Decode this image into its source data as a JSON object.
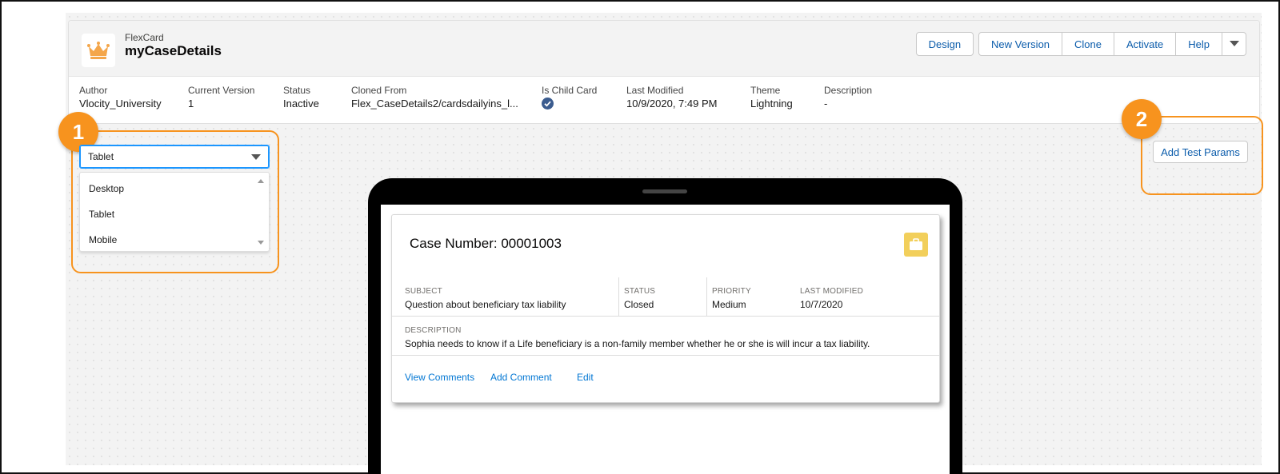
{
  "header": {
    "object_type": "FlexCard",
    "title": "myCaseDetails",
    "buttons": {
      "design": "Design",
      "new_version": "New Version",
      "clone": "Clone",
      "activate": "Activate",
      "help": "Help"
    },
    "fields": {
      "author": {
        "label": "Author",
        "value": "Vlocity_University"
      },
      "current_version": {
        "label": "Current Version",
        "value": "1"
      },
      "status": {
        "label": "Status",
        "value": "Inactive"
      },
      "cloned_from": {
        "label": "Cloned From",
        "value": "Flex_CaseDetails2/cardsdailyins_l..."
      },
      "is_child_card": {
        "label": "Is Child Card"
      },
      "last_modified": {
        "label": "Last Modified",
        "value": "10/9/2020, 7:49 PM"
      },
      "theme": {
        "label": "Theme",
        "value": "Lightning"
      },
      "description": {
        "label": "Description",
        "value": "-"
      }
    }
  },
  "callouts": {
    "one": "1",
    "two": "2"
  },
  "device_select": {
    "selected": "Tablet",
    "options": [
      "Desktop",
      "Tablet",
      "Mobile"
    ]
  },
  "add_test_params": "Add Test Params",
  "card": {
    "title": "Case Number: 00001003",
    "subject": {
      "label": "SUBJECT",
      "value": "Question about beneficiary tax liability"
    },
    "status": {
      "label": "STATUS",
      "value": "Closed"
    },
    "priority": {
      "label": "PRIORITY",
      "value": "Medium"
    },
    "last_modified": {
      "label": "LAST MODIFIED",
      "value": "10/7/2020"
    },
    "description": {
      "label": "DESCRIPTION",
      "value": "Sophia needs to know if a Life beneficiary is a non-family member whether he or she is will incur a tax liability."
    },
    "actions": {
      "view_comments": "View Comments",
      "add_comment": "Add Comment",
      "edit": "Edit"
    }
  },
  "colors": {
    "accent_orange": "#f7931e",
    "link_blue": "#0176d3",
    "case_icon_yellow": "#f2cf5b",
    "check_blue": "#3b5c8f"
  }
}
